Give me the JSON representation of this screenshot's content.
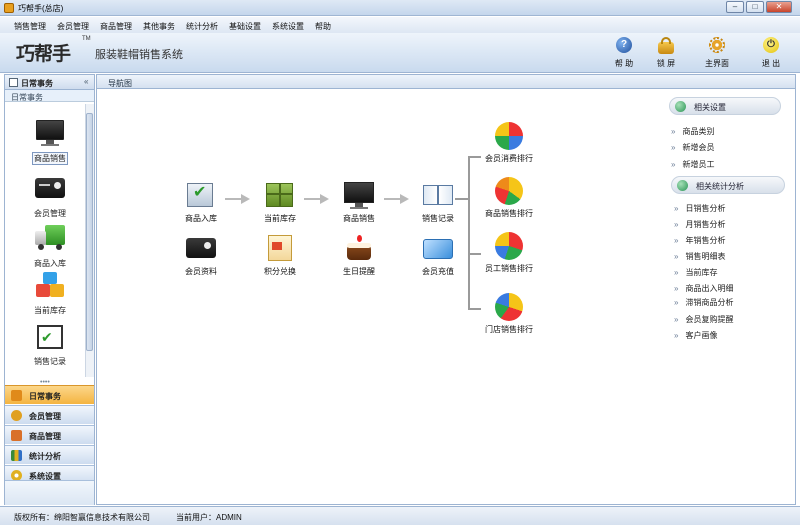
{
  "window": {
    "title": "巧帮手(总店)"
  },
  "menu": [
    "销售管理",
    "会员管理",
    "商品管理",
    "其他事务",
    "统计分析",
    "基础设置",
    "系统设置",
    "帮助"
  ],
  "banner": {
    "logo": "巧帮手",
    "tm": "TM",
    "subtitle": "服装鞋帽销售系统"
  },
  "tools": [
    {
      "icon": "help-icon",
      "label": "帮 助"
    },
    {
      "icon": "lock-icon",
      "label": "锁 屏"
    },
    {
      "icon": "gear-icon",
      "label": "主界面"
    },
    {
      "icon": "power-icon",
      "label": "退 出"
    }
  ],
  "sidebar": {
    "header": "日常事务",
    "collapse": "«",
    "section": "日常事务",
    "grip": "••••",
    "items": [
      {
        "icon": "monitor-icon",
        "label": "商品销售"
      },
      {
        "icon": "id-card-icon",
        "label": "会员管理"
      },
      {
        "icon": "truck-icon",
        "label": "商品入库"
      },
      {
        "icon": "boxes-icon",
        "label": "当前库存"
      },
      {
        "icon": "checklist-icon",
        "label": "销售记录"
      }
    ],
    "accordion": [
      {
        "icon": "calendar-icon",
        "label": "日常事务",
        "color": "#e08a1a"
      },
      {
        "icon": "members-icon",
        "label": "会员管理",
        "color": "#e0a020"
      },
      {
        "icon": "goods-icon",
        "label": "商品管理",
        "color": "#d9702a"
      },
      {
        "icon": "stats-icon",
        "label": "统计分析",
        "color": "#3a8a3a"
      },
      {
        "icon": "settings-icon",
        "label": "系统设置",
        "color": "#e0b020"
      }
    ]
  },
  "nav": {
    "title": "导航图"
  },
  "flow": {
    "row1": [
      "商品入库",
      "当前库存",
      "商品销售",
      "销售记录"
    ],
    "row2": [
      "会员资料",
      "积分兑换",
      "生日提醒",
      "会员充值"
    ],
    "rankings": [
      "会员消费排行",
      "商品销售排行",
      "员工销售排行",
      "门店销售排行"
    ]
  },
  "right": {
    "settings_title": "相关设置",
    "settings": [
      "商品类别",
      "新增会员",
      "新增员工"
    ],
    "stats_title": "相关统计分析",
    "stats": [
      "日销售分析",
      "月销售分析",
      "年销售分析",
      "销售明细表",
      "当前库存",
      "商品出入明细",
      "滞销商品分析",
      "会员复购提醒",
      "客户画像"
    ],
    "chevron": "»"
  },
  "status": {
    "copyright": "版权所有：绵阳智赢信息技术有限公司",
    "user": "当前用户：ADMIN"
  }
}
